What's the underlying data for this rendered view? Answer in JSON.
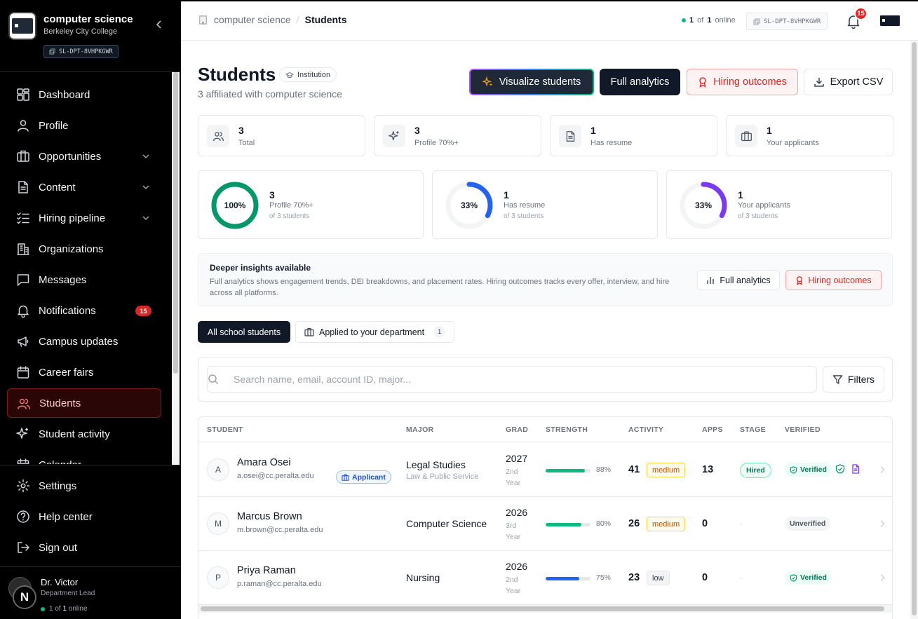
{
  "sidebar": {
    "title": "computer science",
    "subtitle": "Berkeley City College",
    "dept_id": "SL-DPT-8VHPKGWR",
    "nav": [
      {
        "label": "Dashboard",
        "icon": "dashboard-icon"
      },
      {
        "label": "Profile",
        "icon": "user-icon"
      },
      {
        "label": "Opportunities",
        "icon": "briefcase-icon",
        "expandable": true
      },
      {
        "label": "Content",
        "icon": "document-icon",
        "expandable": true
      },
      {
        "label": "Hiring pipeline",
        "icon": "list-check-icon",
        "expandable": true
      },
      {
        "label": "Organizations",
        "icon": "building-icon"
      },
      {
        "label": "Messages",
        "icon": "message-icon"
      },
      {
        "label": "Notifications",
        "icon": "bell-icon",
        "badge": "15"
      },
      {
        "label": "Campus updates",
        "icon": "megaphone-icon"
      },
      {
        "label": "Career fairs",
        "icon": "calendar-icon"
      },
      {
        "label": "Students",
        "icon": "users-icon",
        "active": true
      },
      {
        "label": "Student activity",
        "icon": "sparkle-icon"
      },
      {
        "label": "Calendar",
        "icon": "calendar-icon"
      }
    ],
    "bottom_nav": [
      {
        "label": "Settings",
        "icon": "gear-icon"
      },
      {
        "label": "Help center",
        "icon": "help-icon"
      },
      {
        "label": "Sign out",
        "icon": "sign-out-icon"
      }
    ],
    "user": {
      "name": "Dr. Victor",
      "role": "Department Lead",
      "online_a": "1",
      "online_of": "of",
      "online_b": "1",
      "online_word": "online",
      "badge_letter": "N"
    }
  },
  "header": {
    "breadcrumb_root": "computer science",
    "breadcrumb_sep": "/",
    "breadcrumb_current": "Students",
    "online_a": "1",
    "online_of": "of",
    "online_b": "1",
    "online_word": "online",
    "dept_id": "SL-DPT-8VHPKGWR",
    "notification_count": "15"
  },
  "page": {
    "title": "Students",
    "chip": "Institution",
    "subtitle": "3 affiliated with computer science",
    "actions": {
      "visualize": "Visualize students",
      "full_analytics": "Full analytics",
      "hiring_outcomes": "Hiring outcomes",
      "export_csv": "Export CSV"
    }
  },
  "stats": [
    {
      "value": "3",
      "label": "Total",
      "icon": "users-icon"
    },
    {
      "value": "3",
      "label": "Profile 70%+",
      "icon": "sparkle-icon"
    },
    {
      "value": "1",
      "label": "Has resume",
      "icon": "document-icon"
    },
    {
      "value": "1",
      "label": "Your applicants",
      "icon": "briefcase-icon"
    }
  ],
  "rings": [
    {
      "pct_label": "100%",
      "fraction": 1.0,
      "color": "#059669",
      "value": "3",
      "label": "Profile 70%+",
      "of": "of 3 students"
    },
    {
      "pct_label": "33%",
      "fraction": 0.33,
      "color": "#2563eb",
      "value": "1",
      "label": "Has resume",
      "of": "of 3 students"
    },
    {
      "pct_label": "33%",
      "fraction": 0.33,
      "color": "#7c3aed",
      "value": "1",
      "label": "Your applicants",
      "of": "of 3 students"
    }
  ],
  "insights": {
    "heading": "Deeper insights available",
    "text": "Full analytics shows engagement trends, DEI breakdowns, and placement rates. Hiring outcomes tracks every offer, interview, and hire across all platforms.",
    "full_analytics": "Full analytics",
    "hiring_outcomes": "Hiring outcomes"
  },
  "tabs": {
    "all": "All school students",
    "applied": "Applied to your department",
    "applied_count": "1"
  },
  "search": {
    "placeholder": "Search name, email, account ID, major...",
    "filters": "Filters"
  },
  "table": {
    "headers": [
      "STUDENT",
      "MAJOR",
      "GRAD",
      "STRENGTH",
      "ACTIVITY",
      "APPS",
      "STAGE",
      "VERIFIED"
    ],
    "rows": [
      {
        "initial": "A",
        "name": "Amara Osei",
        "email": "a.osei@cc.peralta.edu",
        "tag": "Applicant",
        "major": "Legal Studies",
        "major_sub": "Law & Public Service",
        "grad_year": "2027",
        "grad_level": "2nd Year",
        "strength": 0.88,
        "strength_label": "88%",
        "strength_color": "#10b981",
        "activity": "41",
        "activity_level": "medium",
        "apps": "13",
        "stage": "Hired",
        "verified": "Verified"
      },
      {
        "initial": "M",
        "name": "Marcus Brown",
        "email": "m.brown@cc.peralta.edu",
        "tag": "",
        "major": "Computer Science",
        "major_sub": "",
        "grad_year": "2026",
        "grad_level": "3rd Year",
        "strength": 0.8,
        "strength_label": "80%",
        "strength_color": "#10b981",
        "activity": "26",
        "activity_level": "medium",
        "apps": "0",
        "stage": "-",
        "verified": "Unverified"
      },
      {
        "initial": "P",
        "name": "Priya Raman",
        "email": "p.raman@cc.peralta.edu",
        "tag": "",
        "major": "Nursing",
        "major_sub": "",
        "grad_year": "2026",
        "grad_level": "2nd Year",
        "strength": 0.75,
        "strength_label": "75%",
        "strength_color": "#2563eb",
        "activity": "23",
        "activity_level": "low",
        "apps": "0",
        "stage": "-",
        "verified": "Verified"
      }
    ]
  }
}
